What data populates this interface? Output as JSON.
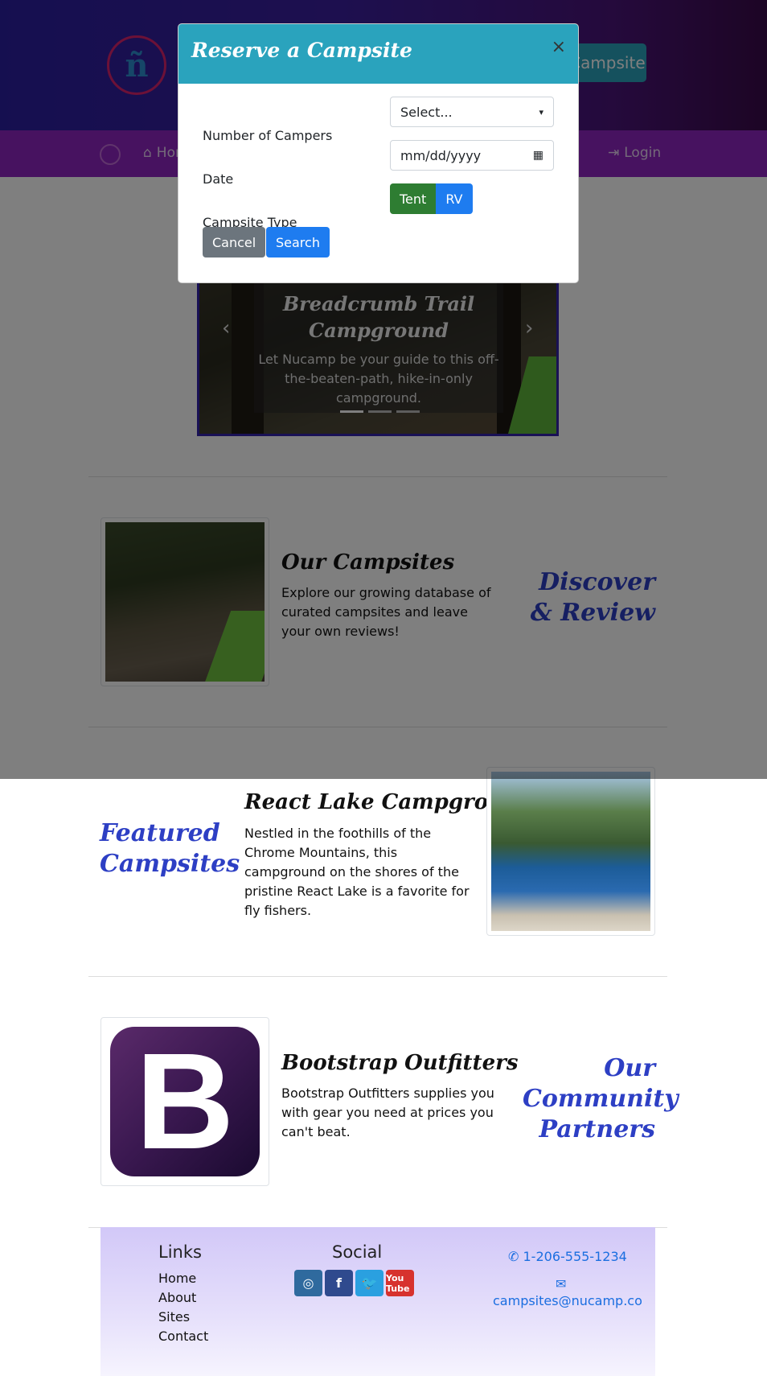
{
  "header": {
    "logo_glyph": "ñ",
    "reserve_label": "Reserve Campsite"
  },
  "navbar": {
    "home_label": "Home",
    "login_label": "Login"
  },
  "carousel": {
    "title": "Breadcrumb Trail Campground",
    "text": "Let Nucamp be your guide to this off-the-beaten-path, hike-in-only campground.",
    "prev_glyph": "‹",
    "next_glyph": "›"
  },
  "sections": {
    "campsites": {
      "side_title": "Discover & Review",
      "title": "Our Campsites",
      "text": "Explore our growing database of curated campsites and leave your own reviews!"
    },
    "featured": {
      "side_title": "Featured Campsites",
      "title": "React Lake Campground",
      "text": "Nestled in the foothills of the Chrome Mountains, this campground on the shores of the pristine React Lake is a favorite for fly fishers."
    },
    "partners": {
      "side_title": "Our Community Partners",
      "title": "Bootstrap Outfitters",
      "text": "Bootstrap Outfitters supplies you with gear you need at prices you can't beat.",
      "logo_letter": "B"
    }
  },
  "footer": {
    "links_title": "Links",
    "links": [
      "Home",
      "About",
      "Sites",
      "Contact"
    ],
    "social_title": "Social",
    "social": [
      {
        "icon": "instagram-icon",
        "glyph": "◎"
      },
      {
        "icon": "facebook-icon",
        "glyph": "f"
      },
      {
        "icon": "twitter-icon",
        "glyph": "🐦"
      },
      {
        "icon": "youtube-icon",
        "glyph": "You Tube"
      }
    ],
    "phone": "1-206-555-1234",
    "email": "campsites@nucamp.co"
  },
  "modal": {
    "title": "Reserve a Campsite",
    "close_glyph": "×",
    "campers_label": "Number of Campers",
    "campers_value": "Select...",
    "date_label": "Date",
    "date_placeholder": "mm/dd/yyyy",
    "type_label": "Campsite Type",
    "type_options": [
      "Tent",
      "RV"
    ],
    "cancel_label": "Cancel",
    "search_label": "Search"
  },
  "colors": {
    "accent": "#2aa3bd",
    "nav": "#8e24c0",
    "section_title": "#2d3fc4",
    "tent": "#2e7d32",
    "primary": "#1e7cf0"
  }
}
